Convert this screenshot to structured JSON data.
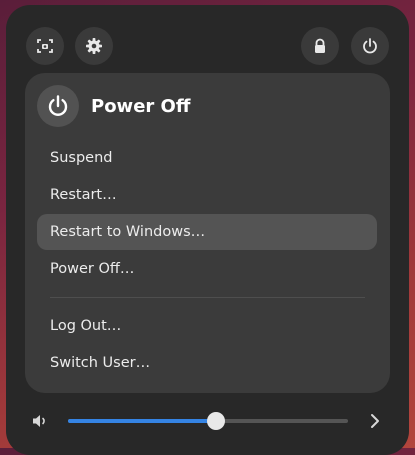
{
  "topbar": {
    "screenshot_icon": "screenshot-icon",
    "settings_icon": "gear-icon",
    "lock_icon": "lock-icon",
    "power_icon": "power-icon"
  },
  "power_menu": {
    "title": "Power Off",
    "items": [
      {
        "label": "Suspend"
      },
      {
        "label": "Restart…"
      },
      {
        "label": "Restart to Windows…",
        "highlighted": true
      },
      {
        "label": "Power Off…"
      },
      {
        "label": "Log Out…"
      },
      {
        "label": "Switch User…"
      }
    ]
  },
  "volume": {
    "icon": "speaker-icon",
    "level": 0.53,
    "expand_icon": "chevron-right-icon"
  },
  "colors": {
    "accent": "#3584e4",
    "panel": "#282828",
    "menu": "#3b3b3b",
    "highlight": "#545454"
  }
}
